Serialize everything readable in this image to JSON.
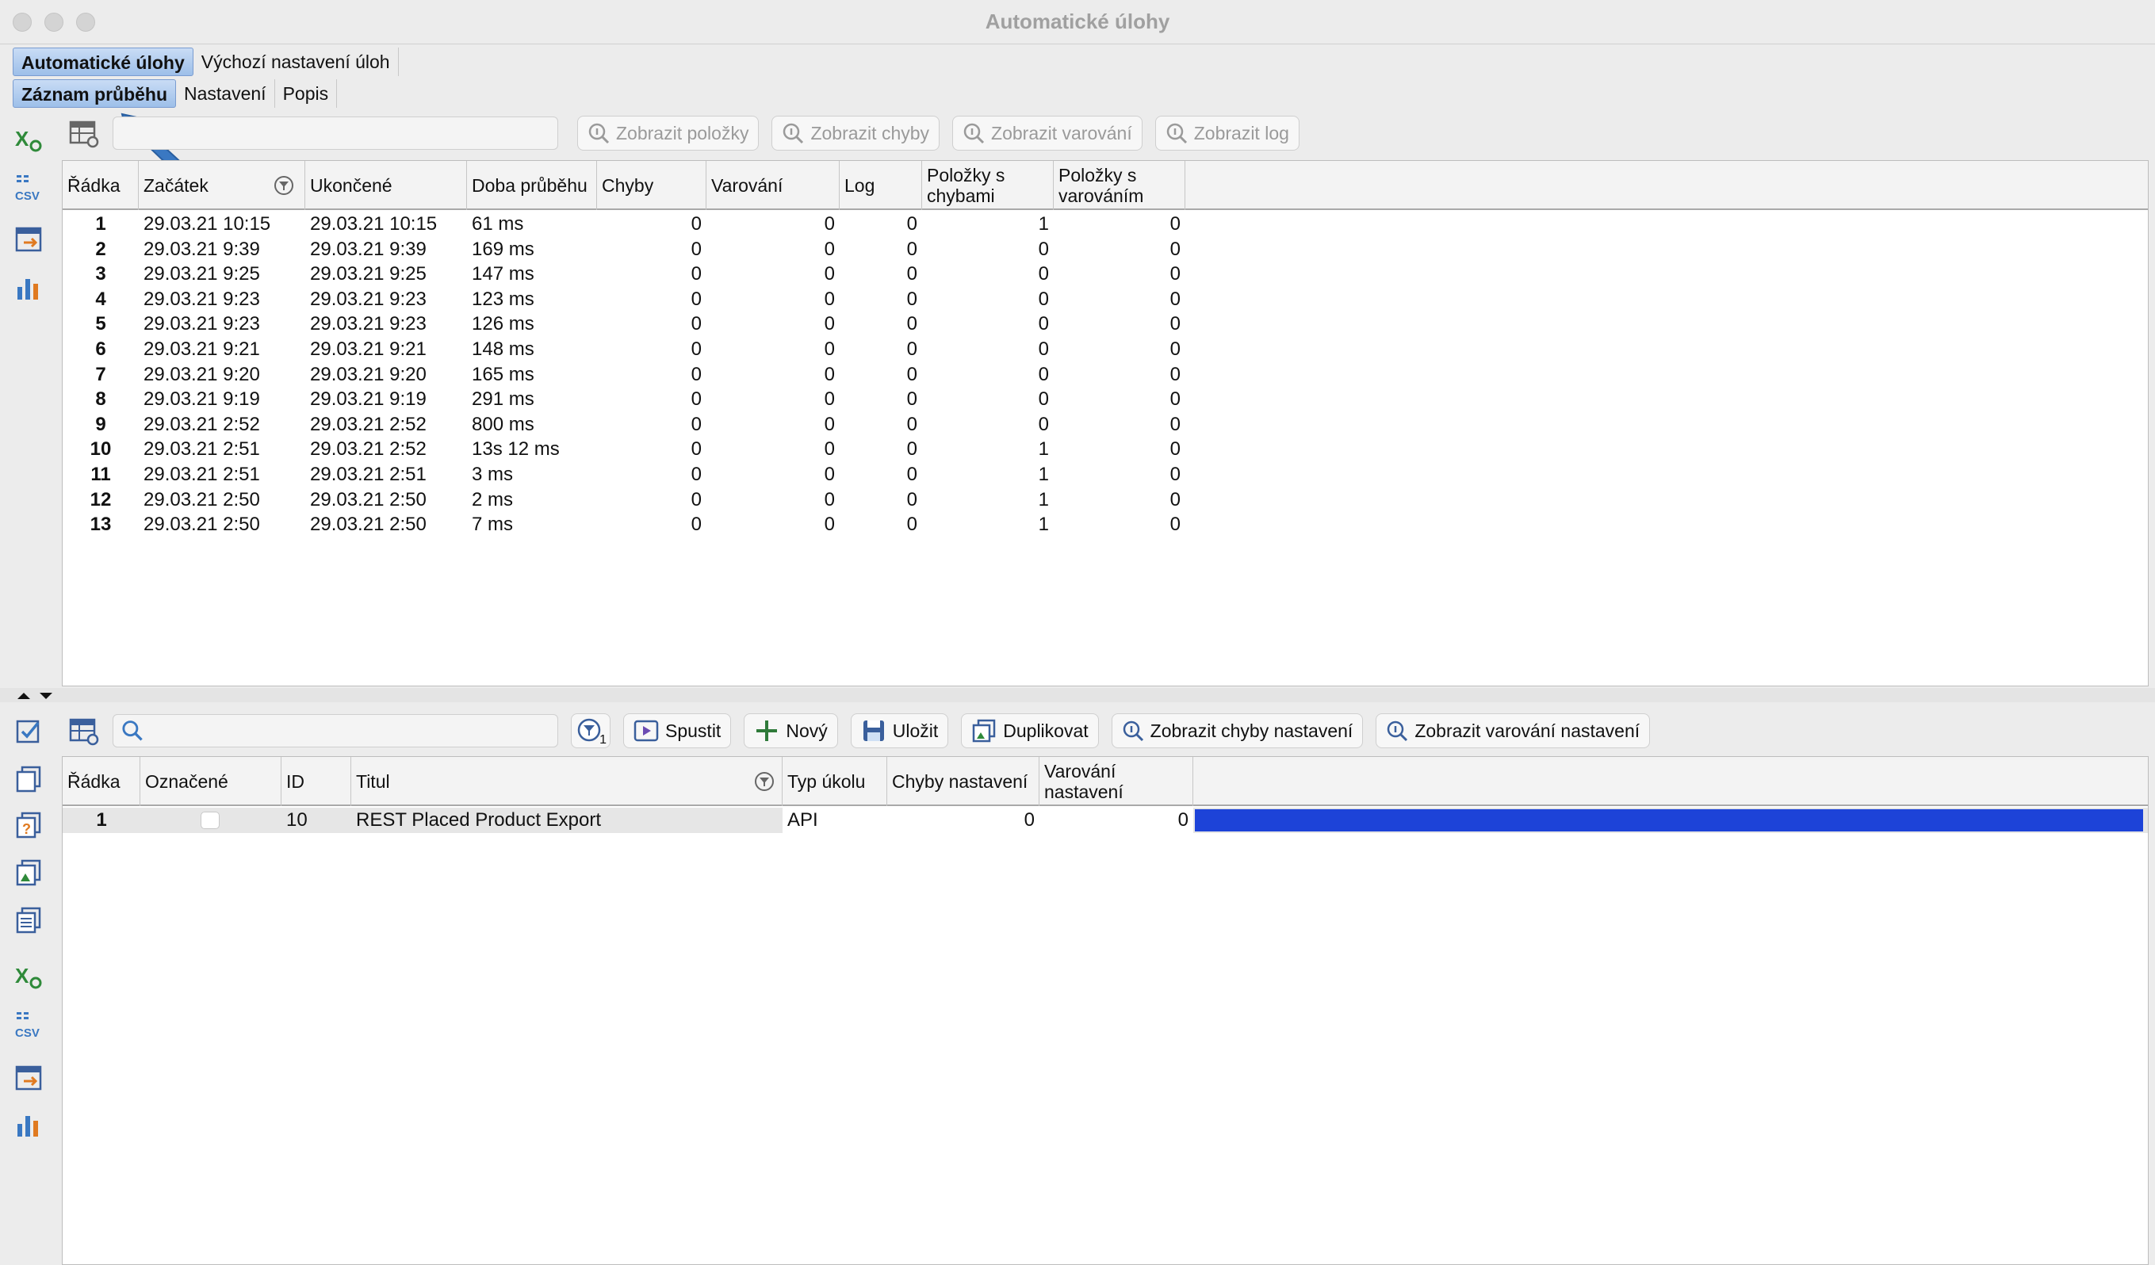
{
  "window": {
    "title": "Automatické úlohy"
  },
  "main_tabs": [
    {
      "label": "Automatické úlohy",
      "active": true
    },
    {
      "label": "Výchozí nastavení úloh",
      "active": false
    }
  ],
  "sub_tabs": [
    {
      "label": "Záznam průběhu",
      "active": true
    },
    {
      "label": "Nastavení",
      "active": false
    },
    {
      "label": "Popis",
      "active": false
    }
  ],
  "top_toolbar": {
    "search_value": "",
    "buttons": [
      {
        "label": "Zobrazit položky",
        "enabled": false
      },
      {
        "label": "Zobrazit chyby",
        "enabled": false
      },
      {
        "label": "Zobrazit varování",
        "enabled": false
      },
      {
        "label": "Zobrazit log",
        "enabled": false
      }
    ]
  },
  "log_table": {
    "columns": [
      "Řádka",
      "Začátek",
      "Ukončené",
      "Doba průběhu",
      "Chyby",
      "Varování",
      "Log",
      "Položky s chybami",
      "Položky s varováním"
    ],
    "rows": [
      [
        "1",
        "29.03.21 10:15",
        "29.03.21 10:15",
        "61 ms",
        "0",
        "0",
        "0",
        "1",
        "0"
      ],
      [
        "2",
        "29.03.21 9:39",
        "29.03.21 9:39",
        "169 ms",
        "0",
        "0",
        "0",
        "0",
        "0"
      ],
      [
        "3",
        "29.03.21 9:25",
        "29.03.21 9:25",
        "147 ms",
        "0",
        "0",
        "0",
        "0",
        "0"
      ],
      [
        "4",
        "29.03.21 9:23",
        "29.03.21 9:23",
        "123 ms",
        "0",
        "0",
        "0",
        "0",
        "0"
      ],
      [
        "5",
        "29.03.21 9:23",
        "29.03.21 9:23",
        "126 ms",
        "0",
        "0",
        "0",
        "0",
        "0"
      ],
      [
        "6",
        "29.03.21 9:21",
        "29.03.21 9:21",
        "148 ms",
        "0",
        "0",
        "0",
        "0",
        "0"
      ],
      [
        "7",
        "29.03.21 9:20",
        "29.03.21 9:20",
        "165 ms",
        "0",
        "0",
        "0",
        "0",
        "0"
      ],
      [
        "8",
        "29.03.21 9:19",
        "29.03.21 9:19",
        "291 ms",
        "0",
        "0",
        "0",
        "0",
        "0"
      ],
      [
        "9",
        "29.03.21 2:52",
        "29.03.21 2:52",
        "800 ms",
        "0",
        "0",
        "0",
        "0",
        "0"
      ],
      [
        "10",
        "29.03.21 2:51",
        "29.03.21 2:52",
        "13s 12 ms",
        "0",
        "0",
        "0",
        "1",
        "0"
      ],
      [
        "11",
        "29.03.21 2:51",
        "29.03.21 2:51",
        "3 ms",
        "0",
        "0",
        "0",
        "1",
        "0"
      ],
      [
        "12",
        "29.03.21 2:50",
        "29.03.21 2:50",
        "2 ms",
        "0",
        "0",
        "0",
        "1",
        "0"
      ],
      [
        "13",
        "29.03.21 2:50",
        "29.03.21 2:50",
        "7 ms",
        "0",
        "0",
        "0",
        "1",
        "0"
      ]
    ]
  },
  "bottom_toolbar": {
    "search_value": "",
    "filter_badge": "1",
    "buttons": [
      {
        "label": "Spustit",
        "icon": "run-icon"
      },
      {
        "label": "Nový",
        "icon": "plus-icon"
      },
      {
        "label": "Uložit",
        "icon": "save-icon"
      },
      {
        "label": "Duplikovat",
        "icon": "duplicate-icon"
      },
      {
        "label": "Zobrazit chyby nastavení",
        "icon": "magnifier-info-icon"
      },
      {
        "label": "Zobrazit varování nastavení",
        "icon": "magnifier-info-icon"
      }
    ]
  },
  "task_table": {
    "columns": [
      "Řádka",
      "Označené",
      "ID",
      "Titul",
      "Typ úkolu",
      "Chyby nastavení",
      "Varování nastavení"
    ],
    "rows": [
      {
        "row": "1",
        "checked": false,
        "id": "10",
        "title": "REST Placed Product Export",
        "type": "API",
        "errors": "0",
        "warnings": "0"
      }
    ]
  },
  "colors": {
    "selection": "#1d43d8",
    "active_tab": "#9dbfe9",
    "pointer_arrow": "#3a78c2"
  }
}
